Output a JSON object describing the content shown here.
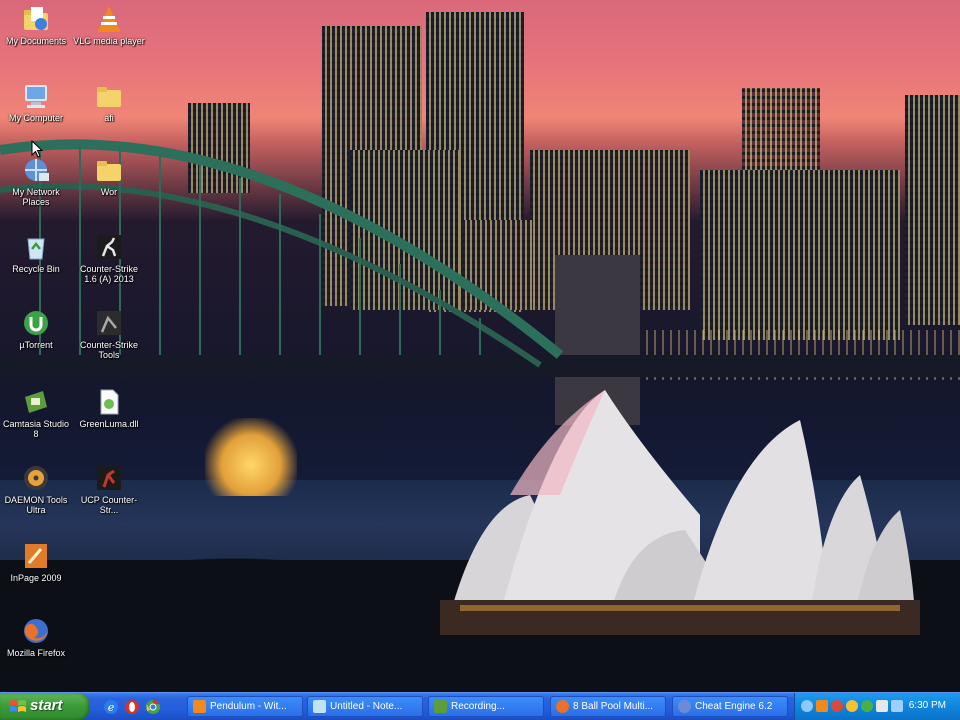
{
  "desktop_icons": [
    {
      "id": "my-documents",
      "label": "My Documents",
      "icon": "folder-documents-icon",
      "color": "#f3d36a"
    },
    {
      "id": "vlc",
      "label": "VLC media player",
      "icon": "vlc-cone-icon",
      "color": "#f08a1e"
    },
    {
      "id": "my-computer",
      "label": "My Computer",
      "icon": "computer-icon",
      "color": "#6fa6e6"
    },
    {
      "id": "afi",
      "label": "afi",
      "icon": "folder-icon",
      "color": "#f3d36a"
    },
    {
      "id": "my-network-places",
      "label": "My Network Places",
      "icon": "network-icon",
      "color": "#5f8fd8"
    },
    {
      "id": "wor",
      "label": "Wor",
      "icon": "folder-icon",
      "color": "#f3d36a"
    },
    {
      "id": "recycle-bin",
      "label": "Recycle Bin",
      "icon": "recycle-bin-icon",
      "color": "#5fb07a"
    },
    {
      "id": "cs16",
      "label": "Counter-Strike 1.6 (A) 2013",
      "icon": "counter-strike-icon",
      "color": "#cfcfcf"
    },
    {
      "id": "utorrent",
      "label": "µTorrent",
      "icon": "utorrent-icon",
      "color": "#3aa346"
    },
    {
      "id": "cs-tools",
      "label": "Counter-Strike Tools",
      "icon": "counter-strike-tools-icon",
      "color": "#9a9a9a"
    },
    {
      "id": "camtasia",
      "label": "Camtasia Studio 8",
      "icon": "camtasia-icon",
      "color": "#5e9d3c"
    },
    {
      "id": "greenluma",
      "label": "GreenLuma.dll",
      "icon": "dll-file-icon",
      "color": "#6fbf4f"
    },
    {
      "id": "daemon",
      "label": "DAEMON Tools Ultra",
      "icon": "daemon-tools-icon",
      "color": "#e8a23a"
    },
    {
      "id": "ucp",
      "label": "UCP Counter-Str...",
      "icon": "ucp-icon",
      "color": "#c0392b"
    },
    {
      "id": "inpage",
      "label": "InPage 2009",
      "icon": "inpage-icon",
      "color": "#e07b2a"
    },
    {
      "id": "firefox",
      "label": "Mozilla Firefox",
      "icon": "firefox-icon",
      "color": "#e8722a"
    }
  ],
  "taskbar": {
    "start_label": "start",
    "quick_launch": [
      {
        "icon": "ie-icon",
        "color": "#2d7be8"
      },
      {
        "icon": "opera-icon",
        "color": "#d8312e"
      },
      {
        "icon": "chrome-icon",
        "color": "#4aa04a"
      }
    ],
    "tasks": [
      {
        "label": "Pendulum - Wit...",
        "icon": "vlc-cone-icon",
        "color": "#f08a1e"
      },
      {
        "label": "Untitled - Note...",
        "icon": "notepad-icon",
        "color": "#bfe3f5"
      },
      {
        "label": "Recording...",
        "icon": "camtasia-icon",
        "color": "#5e9d3c"
      },
      {
        "label": "8 Ball Pool Multi...",
        "icon": "firefox-icon",
        "color": "#e8722a"
      },
      {
        "label": "Cheat Engine 6.2",
        "icon": "cheat-engine-icon",
        "color": "#6b8bd6"
      }
    ],
    "tray_icons": [
      {
        "icon": "network-tray-icon",
        "color": "#8ec8ff"
      },
      {
        "icon": "vlc-tray-icon",
        "color": "#f08a1e"
      },
      {
        "icon": "shield-tray-icon",
        "color": "#d94a3a"
      },
      {
        "icon": "smiley-tray-icon",
        "color": "#f2c230"
      },
      {
        "icon": "green-tray-icon",
        "color": "#47b04a"
      },
      {
        "icon": "speaker-tray-icon",
        "color": "#e7e7e7"
      },
      {
        "icon": "monitor-tray-icon",
        "color": "#9fd0ff"
      }
    ],
    "clock": "6:30 PM"
  },
  "colors": {
    "taskbar_blue": "#245edb",
    "start_green": "#3c9a39",
    "tray_blue": "#0f86dd"
  }
}
